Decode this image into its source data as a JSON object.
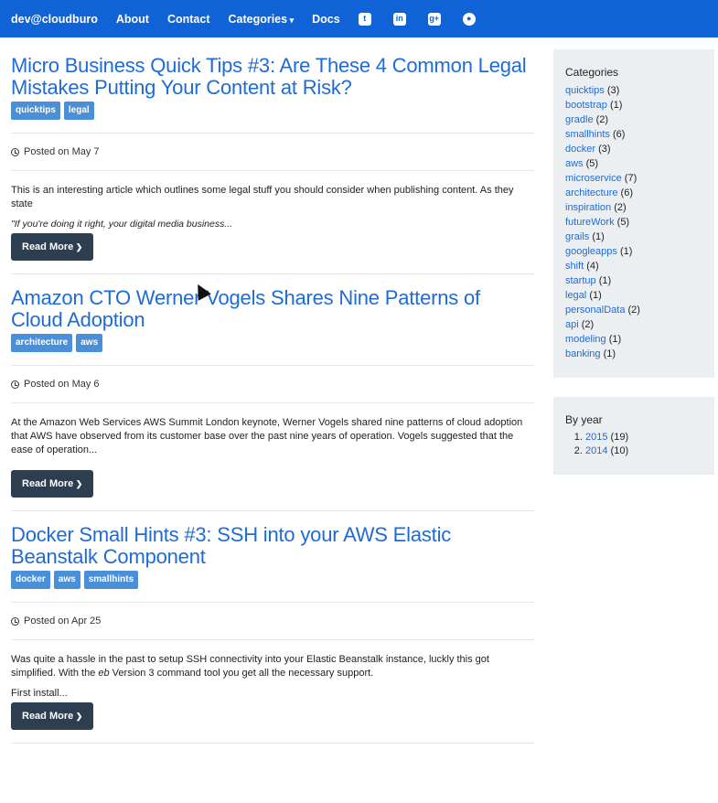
{
  "nav": {
    "brand": "dev@cloudburo",
    "about": "About",
    "contact": "Contact",
    "categories": "Categories",
    "docs": "Docs",
    "social_icons": [
      "twitter-icon",
      "linkedin-icon",
      "google-plus-icon",
      "github-icon"
    ]
  },
  "posts": [
    {
      "title": "Micro Business Quick Tips #3: Are These 4 Common Legal Mistakes Putting Your Content at Risk?",
      "tags": [
        "quicktips",
        "legal"
      ],
      "date": "Posted on May 7",
      "excerpt": "This is an interesting article which outlines some legal stuff you should consider when publishing content. As they state",
      "quote": "\"If you're doing it right, your digital media business...",
      "read_more": "Read More"
    },
    {
      "title": "Amazon CTO Werner Vogels Shares Nine Patterns of Cloud Adoption",
      "tags": [
        "architecture",
        "aws"
      ],
      "date": "Posted on May 6",
      "excerpt": " At the Amazon Web Services AWS Summit London keynote, Werner Vogels shared nine patterns of cloud adoption that AWS have observed from its customer base over the past nine years of operation. Vogels suggested that the ease of operation...",
      "read_more": "Read More"
    },
    {
      "title": "Docker Small Hints #3: SSH into your AWS Elastic Beanstalk Component",
      "tags": [
        "docker",
        "aws",
        "smallhints"
      ],
      "date": "Posted on Apr 25",
      "excerpt_part1": "Was quite a hassle in the past to setup SSH connectivity into your Elastic Beanstalk instance, luckly this got simplified. With the ",
      "excerpt_em": "eb",
      "excerpt_part2": " Version 3 command tool you get all the necessary support.",
      "first_line": "First install...",
      "read_more": "Read More"
    }
  ],
  "sidebar": {
    "categories_heading": "Categories",
    "categories": [
      {
        "name": "quicktips",
        "count": "(3)"
      },
      {
        "name": "bootstrap",
        "count": "(1)"
      },
      {
        "name": "gradle",
        "count": "(2)"
      },
      {
        "name": "smallhints",
        "count": "(6)"
      },
      {
        "name": "docker",
        "count": "(3)"
      },
      {
        "name": "aws",
        "count": "(5)"
      },
      {
        "name": "microservice",
        "count": "(7)"
      },
      {
        "name": "architecture",
        "count": "(6)"
      },
      {
        "name": "inspiration",
        "count": "(2)"
      },
      {
        "name": "futureWork",
        "count": "(5)"
      },
      {
        "name": "grails",
        "count": "(1)"
      },
      {
        "name": "googleapps",
        "count": "(1)"
      },
      {
        "name": "shift",
        "count": "(4)"
      },
      {
        "name": "startup",
        "count": "(1)"
      },
      {
        "name": "legal",
        "count": "(1)"
      },
      {
        "name": "personalData",
        "count": "(2)"
      },
      {
        "name": "api",
        "count": "(2)"
      },
      {
        "name": "modeling",
        "count": "(1)"
      },
      {
        "name": "banking",
        "count": "(1)"
      }
    ],
    "by_year_heading": "By year",
    "years": [
      {
        "year": "2015",
        "count": "(19)"
      },
      {
        "year": "2014",
        "count": "(10)"
      }
    ]
  },
  "colors": {
    "navbar": "#0f63d6",
    "link": "#1f6bd6",
    "tag": "#4a90d9",
    "button": "#2e3e51",
    "sidebar_bg": "#eceff1"
  }
}
